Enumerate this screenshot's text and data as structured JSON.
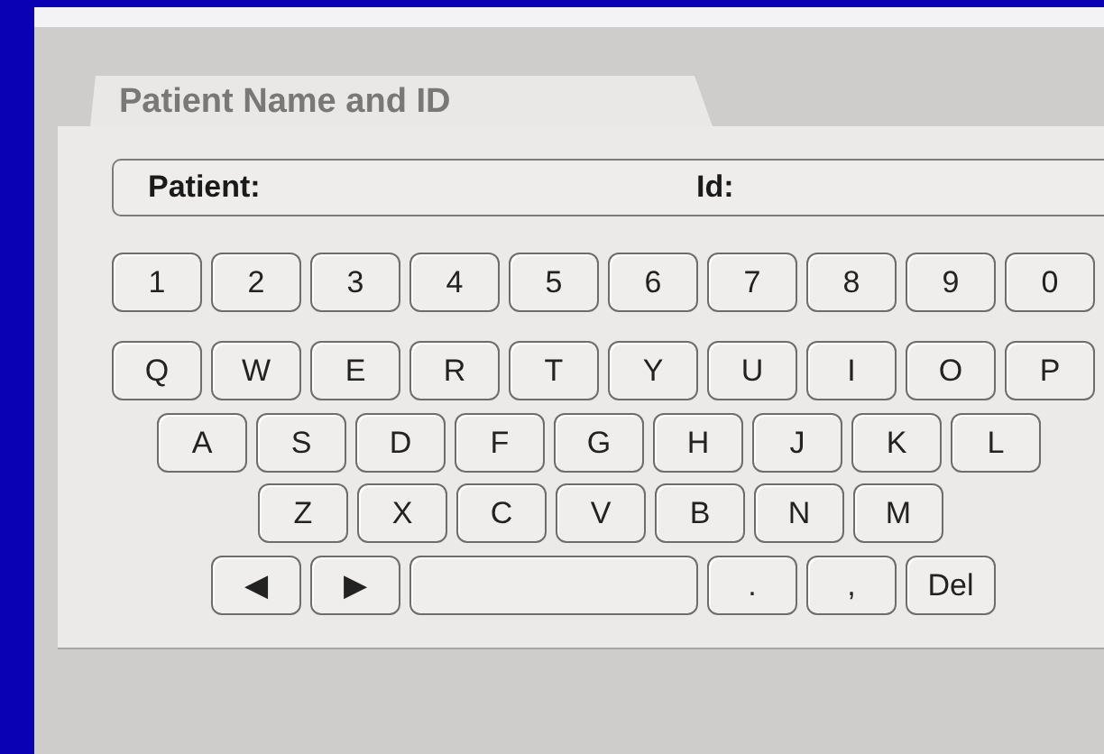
{
  "tab": {
    "label": "Patient Name and ID",
    "selected": true
  },
  "field": {
    "patient_label": "Patient:",
    "id_label": "Id:"
  },
  "keyboard": {
    "rows": [
      {
        "keys": [
          {
            "kind": "key",
            "label": "1"
          },
          {
            "kind": "key",
            "label": "2"
          },
          {
            "kind": "key",
            "label": "3"
          },
          {
            "kind": "key",
            "label": "4"
          },
          {
            "kind": "key",
            "label": "5"
          },
          {
            "kind": "key",
            "label": "6"
          },
          {
            "kind": "key",
            "label": "7"
          },
          {
            "kind": "key",
            "label": "8"
          },
          {
            "kind": "key",
            "label": "9"
          },
          {
            "kind": "key",
            "label": "0"
          }
        ]
      },
      {
        "keys": [
          {
            "kind": "key",
            "label": "Q"
          },
          {
            "kind": "key",
            "label": "W"
          },
          {
            "kind": "key",
            "label": "E"
          },
          {
            "kind": "key",
            "label": "R"
          },
          {
            "kind": "key",
            "label": "T"
          },
          {
            "kind": "key",
            "label": "Y"
          },
          {
            "kind": "key",
            "label": "U"
          },
          {
            "kind": "key",
            "label": "I"
          },
          {
            "kind": "key",
            "label": "O"
          },
          {
            "kind": "key",
            "label": "P"
          }
        ]
      },
      {
        "keys": [
          {
            "kind": "key",
            "label": "A"
          },
          {
            "kind": "key",
            "label": "S"
          },
          {
            "kind": "key",
            "label": "D"
          },
          {
            "kind": "key",
            "label": "F"
          },
          {
            "kind": "key",
            "label": "G"
          },
          {
            "kind": "key",
            "label": "H"
          },
          {
            "kind": "key",
            "label": "J"
          },
          {
            "kind": "key",
            "label": "K"
          },
          {
            "kind": "key",
            "label": "L"
          }
        ]
      },
      {
        "keys": [
          {
            "kind": "key",
            "label": "Z"
          },
          {
            "kind": "key",
            "label": "X"
          },
          {
            "kind": "key",
            "label": "C"
          },
          {
            "kind": "key",
            "label": "V"
          },
          {
            "kind": "key",
            "label": "B"
          },
          {
            "kind": "key",
            "label": "N"
          },
          {
            "kind": "key",
            "label": "M"
          }
        ]
      },
      {
        "keys": [
          {
            "kind": "key",
            "label": "◀"
          },
          {
            "kind": "key",
            "label": "▶"
          },
          {
            "kind": "space"
          },
          {
            "kind": "key",
            "label": "."
          },
          {
            "kind": "key",
            "label": ","
          },
          {
            "kind": "key",
            "label": "Del"
          }
        ]
      }
    ]
  }
}
